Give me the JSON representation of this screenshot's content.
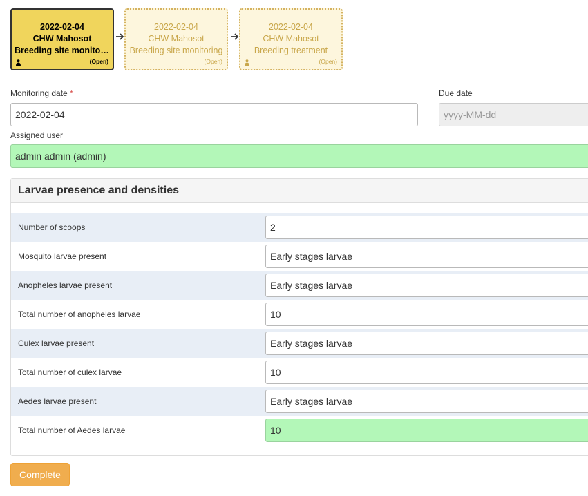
{
  "stages": [
    {
      "date": "2022-02-04",
      "actor": "CHW Mahosot",
      "name": "Breeding site monitori…",
      "status": "(Open)"
    },
    {
      "date": "2022-02-04",
      "actor": "CHW Mahosot",
      "name": "Breeding site monitoring",
      "status": "(Open)"
    },
    {
      "date": "2022-02-04",
      "actor": "CHW Mahosot",
      "name": "Breeding treatment",
      "status": "(Open)"
    }
  ],
  "form": {
    "monitoring_date_label": "Monitoring date",
    "required_mark": "*",
    "monitoring_date_value": "2022-02-04",
    "due_date_label": "Due date",
    "due_date_placeholder": "yyyy-MM-dd",
    "assigned_user_label": "Assigned user",
    "assigned_user_value": "admin admin (admin)"
  },
  "panel": {
    "title": "Larvae presence and densities",
    "rows": [
      {
        "label": "Number of scoops",
        "value": "2"
      },
      {
        "label": "Mosquito larvae present",
        "value": "Early stages larvae"
      },
      {
        "label": "Anopheles larvae present",
        "value": "Early stages larvae"
      },
      {
        "label": "Total number of anopheles larvae",
        "value": "10"
      },
      {
        "label": "Culex larvae present",
        "value": "Early stages larvae"
      },
      {
        "label": "Total number of culex larvae",
        "value": "10"
      },
      {
        "label": "Aedes larvae present",
        "value": "Early stages larvae"
      },
      {
        "label": "Total number of Aedes larvae",
        "value": "10"
      }
    ]
  },
  "actions": {
    "complete_label": "Complete"
  },
  "colors": {
    "active_stage": "#f0d55c",
    "pending_stage": "#fdf6dd",
    "highlight_field": "#b3f7b8",
    "row_shade": "#e8eef6",
    "complete_button": "#f0ad4e"
  },
  "icons": {
    "stage_user": "person-icon",
    "stage_link": "arrow-right-icon"
  }
}
